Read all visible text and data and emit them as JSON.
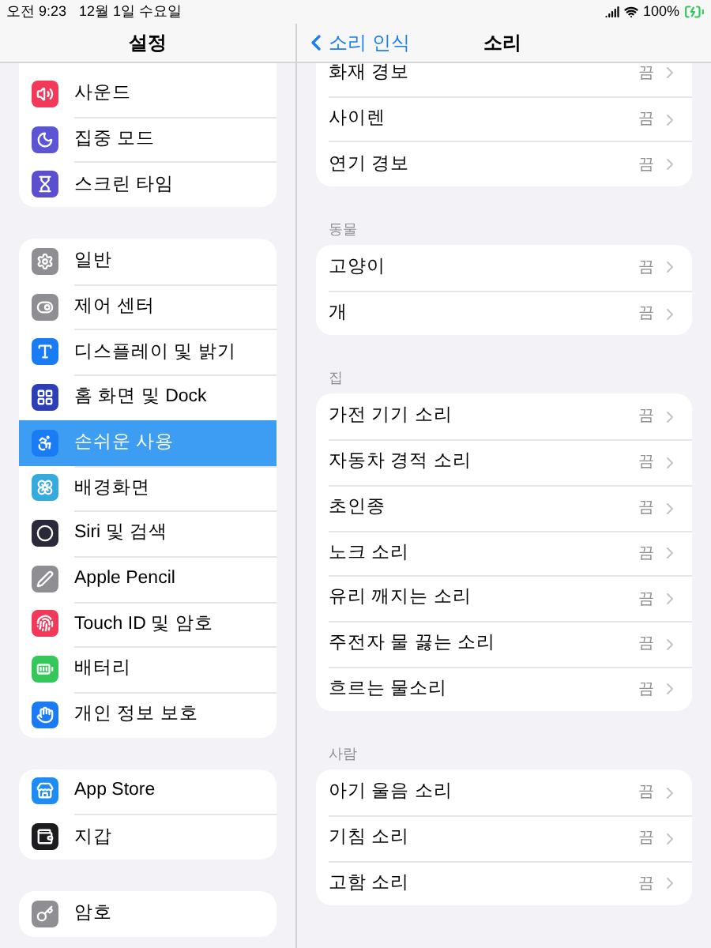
{
  "status_bar": {
    "time": "오전 9:23",
    "date": "12월 1일 수요일",
    "battery": "100%"
  },
  "sidebar": {
    "title": "설정",
    "groups": [
      {
        "items": [
          {
            "label": "사운드",
            "color": "#f2395a",
            "selected": false
          },
          {
            "label": "집중 모드",
            "color": "#5b55d6",
            "selected": false
          },
          {
            "label": "스크린 타임",
            "color": "#5b4fcf",
            "selected": false
          }
        ]
      },
      {
        "items": [
          {
            "label": "일반",
            "color": "#8e8e93",
            "selected": false
          },
          {
            "label": "제어 센터",
            "color": "#8e8e93",
            "selected": false
          },
          {
            "label": "디스플레이 및 밝기",
            "color": "#1a7cf5",
            "selected": false
          },
          {
            "label": "홈 화면 및 Dock",
            "color": "#2d3fb8",
            "selected": false
          },
          {
            "label": "손쉬운 사용",
            "color": "#1a7cf5",
            "selected": true
          },
          {
            "label": "배경화면",
            "color": "#35aadc",
            "selected": false
          },
          {
            "label": "Siri 및 검색",
            "color": "#2a2a3a",
            "selected": false
          },
          {
            "label": "Apple Pencil",
            "color": "#8e8e93",
            "selected": false
          },
          {
            "label": "Touch ID 및 암호",
            "color": "#f2395a",
            "selected": false
          },
          {
            "label": "배터리",
            "color": "#34c759",
            "selected": false
          },
          {
            "label": "개인 정보 보호",
            "color": "#1a7cf5",
            "selected": false
          }
        ]
      },
      {
        "items": [
          {
            "label": "App Store",
            "color": "#1d8cf5",
            "selected": false
          },
          {
            "label": "지갑",
            "color": "#1c1c1e",
            "selected": false
          }
        ]
      },
      {
        "items": [
          {
            "label": "암호",
            "color": "#8e8e93",
            "selected": false
          }
        ]
      }
    ]
  },
  "detail": {
    "back": "소리 인식",
    "title": "소리",
    "sections": [
      {
        "rows": [
          {
            "label": "화재 경보",
            "value": "끔"
          },
          {
            "label": "사이렌",
            "value": "끔"
          },
          {
            "label": "연기 경보",
            "value": "끔"
          }
        ]
      },
      {
        "header": "동물",
        "rows": [
          {
            "label": "고양이",
            "value": "끔"
          },
          {
            "label": "개",
            "value": "끔"
          }
        ]
      },
      {
        "header": "집",
        "rows": [
          {
            "label": "가전 기기 소리",
            "value": "끔"
          },
          {
            "label": "자동차 경적 소리",
            "value": "끔"
          },
          {
            "label": "초인종",
            "value": "끔"
          },
          {
            "label": "노크 소리",
            "value": "끔"
          },
          {
            "label": "유리 깨지는 소리",
            "value": "끔"
          },
          {
            "label": "주전자 물 끓는 소리",
            "value": "끔"
          },
          {
            "label": "흐르는 물소리",
            "value": "끔"
          }
        ]
      },
      {
        "header": "사람",
        "rows": [
          {
            "label": "아기 울음 소리",
            "value": "끔"
          },
          {
            "label": "기침 소리",
            "value": "끔"
          },
          {
            "label": "고함 소리",
            "value": "끔"
          }
        ]
      }
    ]
  }
}
